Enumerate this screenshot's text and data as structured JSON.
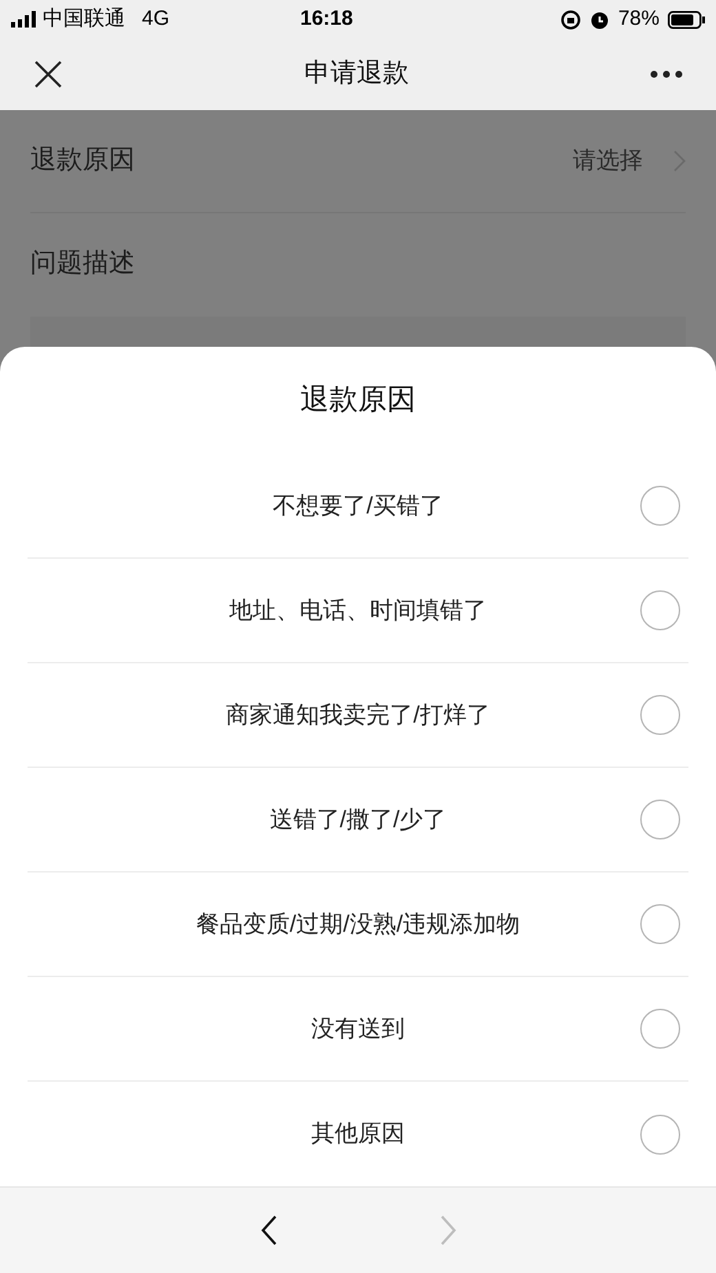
{
  "status_bar": {
    "carrier": "中国联通",
    "network": "4G",
    "time": "16:18",
    "battery": "78%"
  },
  "nav_bar": {
    "title": "申请退款"
  },
  "form": {
    "reason": {
      "label": "退款原因",
      "value": "请选择"
    },
    "description": {
      "label": "问题描述"
    }
  },
  "sheet": {
    "title": "退款原因",
    "options": [
      {
        "label": "不想要了/买错了",
        "selected": false
      },
      {
        "label": "地址、电话、时间填错了",
        "selected": false
      },
      {
        "label": "商家通知我卖完了/打烊了",
        "selected": false
      },
      {
        "label": "送错了/撒了/少了",
        "selected": false
      },
      {
        "label": "餐品变质/过期/没熟/违规添加物",
        "selected": false
      },
      {
        "label": "没有送到",
        "selected": false
      },
      {
        "label": "其他原因",
        "selected": false
      }
    ]
  },
  "toolbar": {
    "back_disabled": false,
    "forward_disabled": true
  }
}
